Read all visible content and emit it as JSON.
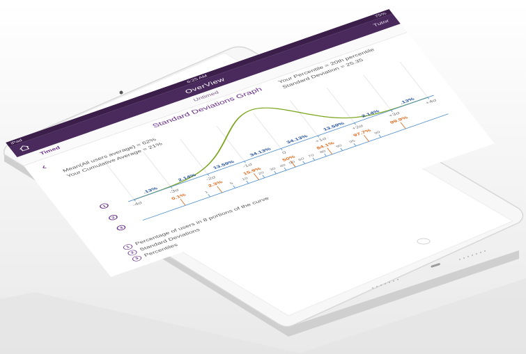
{
  "status": {
    "left": "iPad",
    "time": "6:25 AM",
    "right": "75%"
  },
  "navbar": {
    "title": "OverView",
    "right_label": "Tutor"
  },
  "tabs": {
    "left": "Timed",
    "center": "Untimed"
  },
  "graph": {
    "title": "Standard Deviations Graph",
    "mean_label": "Mean(All users average) = 62%",
    "user_avg_label": "Your Cumulative Average = 21%",
    "percentile_label": "Your Percentile = 20th percentile",
    "std_label": "Standard Deviation = 25.35"
  },
  "chart_data": {
    "type": "area",
    "segment_percentages": [
      ".13%",
      "2.14%",
      "13.59%",
      "34.13%",
      "34.13%",
      "13.59%",
      "2.14%",
      ".13%"
    ],
    "sigma_labels": [
      "-4σ",
      "-3σ",
      "-2σ",
      "-1σ",
      "0",
      "+1σ",
      "+2σ",
      "+3σ",
      "+4σ"
    ],
    "cumulative_percentages": [
      "0.1%",
      "2.3%",
      "15.9%",
      "50%",
      "84.1%",
      "97.7%",
      "99.9%"
    ],
    "percentile_ticks": [
      "1",
      "5",
      "10",
      "20",
      "30",
      "40",
      "50",
      "60",
      "70",
      "80",
      "90",
      "95",
      "99"
    ]
  },
  "legend": [
    {
      "num": "1",
      "label": "Percentage of users in 8 portions of the curve"
    },
    {
      "num": "2",
      "label": "Standard Deviations"
    },
    {
      "num": "3",
      "label": "Percentiles"
    }
  ],
  "colors": {
    "accent": "#6a2f8a",
    "curve": "#7aa51b",
    "blue": "#1f4f9a",
    "orange": "#e06a1f",
    "nav": "#4a2a5c"
  }
}
